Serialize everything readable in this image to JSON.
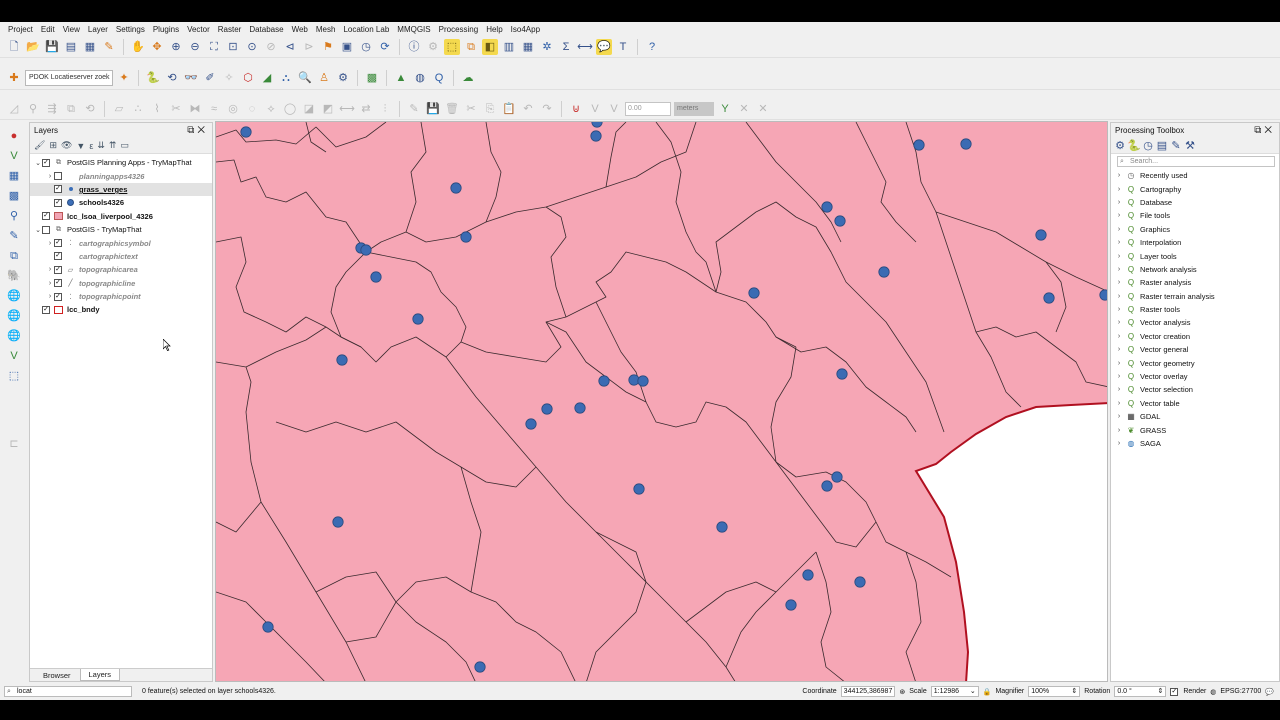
{
  "menu": [
    "Project",
    "Edit",
    "View",
    "Layer",
    "Settings",
    "Plugins",
    "Vector",
    "Raster",
    "Database",
    "Web",
    "Mesh",
    "Location Lab",
    "MMQGIS",
    "Processing",
    "Help",
    "Iso4App"
  ],
  "toolbar2": {
    "pdok_search_label": "PDOK Locatieserver zoek"
  },
  "toolbar3": {
    "value_field": "0.00",
    "unit_select": "meters"
  },
  "layers_panel": {
    "title": "Layers",
    "tabs": [
      "Browser",
      "Layers"
    ],
    "active_tab": "Layers",
    "rows": [
      {
        "label": "PostGIS Planning Apps - TryMapThat",
        "checked": true
      },
      {
        "label": "planningapps4326",
        "checked": false
      },
      {
        "label": "grass_verges",
        "checked": true
      },
      {
        "label": "schools4326",
        "checked": true
      },
      {
        "label": "lcc_lsoa_liverpool_4326",
        "checked": true
      },
      {
        "label": "PostGIS - TryMapThat",
        "checked": false
      },
      {
        "label": "cartographicsymbol",
        "checked": true
      },
      {
        "label": "cartographictext",
        "checked": true
      },
      {
        "label": "topographicarea",
        "checked": true
      },
      {
        "label": "topographicline",
        "checked": true
      },
      {
        "label": "topographicpoint",
        "checked": true
      },
      {
        "label": "lcc_bndy",
        "checked": true
      }
    ]
  },
  "toolbox": {
    "title": "Processing Toolbox",
    "search_placeholder": "Search...",
    "groups": [
      "Recently used",
      "Cartography",
      "Database",
      "File tools",
      "Graphics",
      "Interpolation",
      "Layer tools",
      "Network analysis",
      "Raster analysis",
      "Raster terrain analysis",
      "Raster tools",
      "Vector analysis",
      "Vector creation",
      "Vector general",
      "Vector geometry",
      "Vector overlay",
      "Vector selection",
      "Vector table",
      "GDAL",
      "GRASS",
      "SAGA"
    ]
  },
  "statusbar": {
    "locator_text": "locat",
    "message": "0 feature(s) selected on layer schools4326.",
    "coordinate_label": "Coordinate",
    "coordinate_value": "344125,386987",
    "scale_label": "Scale",
    "scale_value": "1:12986",
    "magnifier_label": "Magnifier",
    "magnifier_value": "100%",
    "rotation_label": "Rotation",
    "rotation_value": "0.0 °",
    "render_label": "Render",
    "crs": "EPSG:27700"
  },
  "colors": {
    "lsoa_fill": "#f6a6b5",
    "lsoa_outline": "#3a2a2e",
    "boundary": "#b01020",
    "school_point": "#3b6bb3"
  }
}
